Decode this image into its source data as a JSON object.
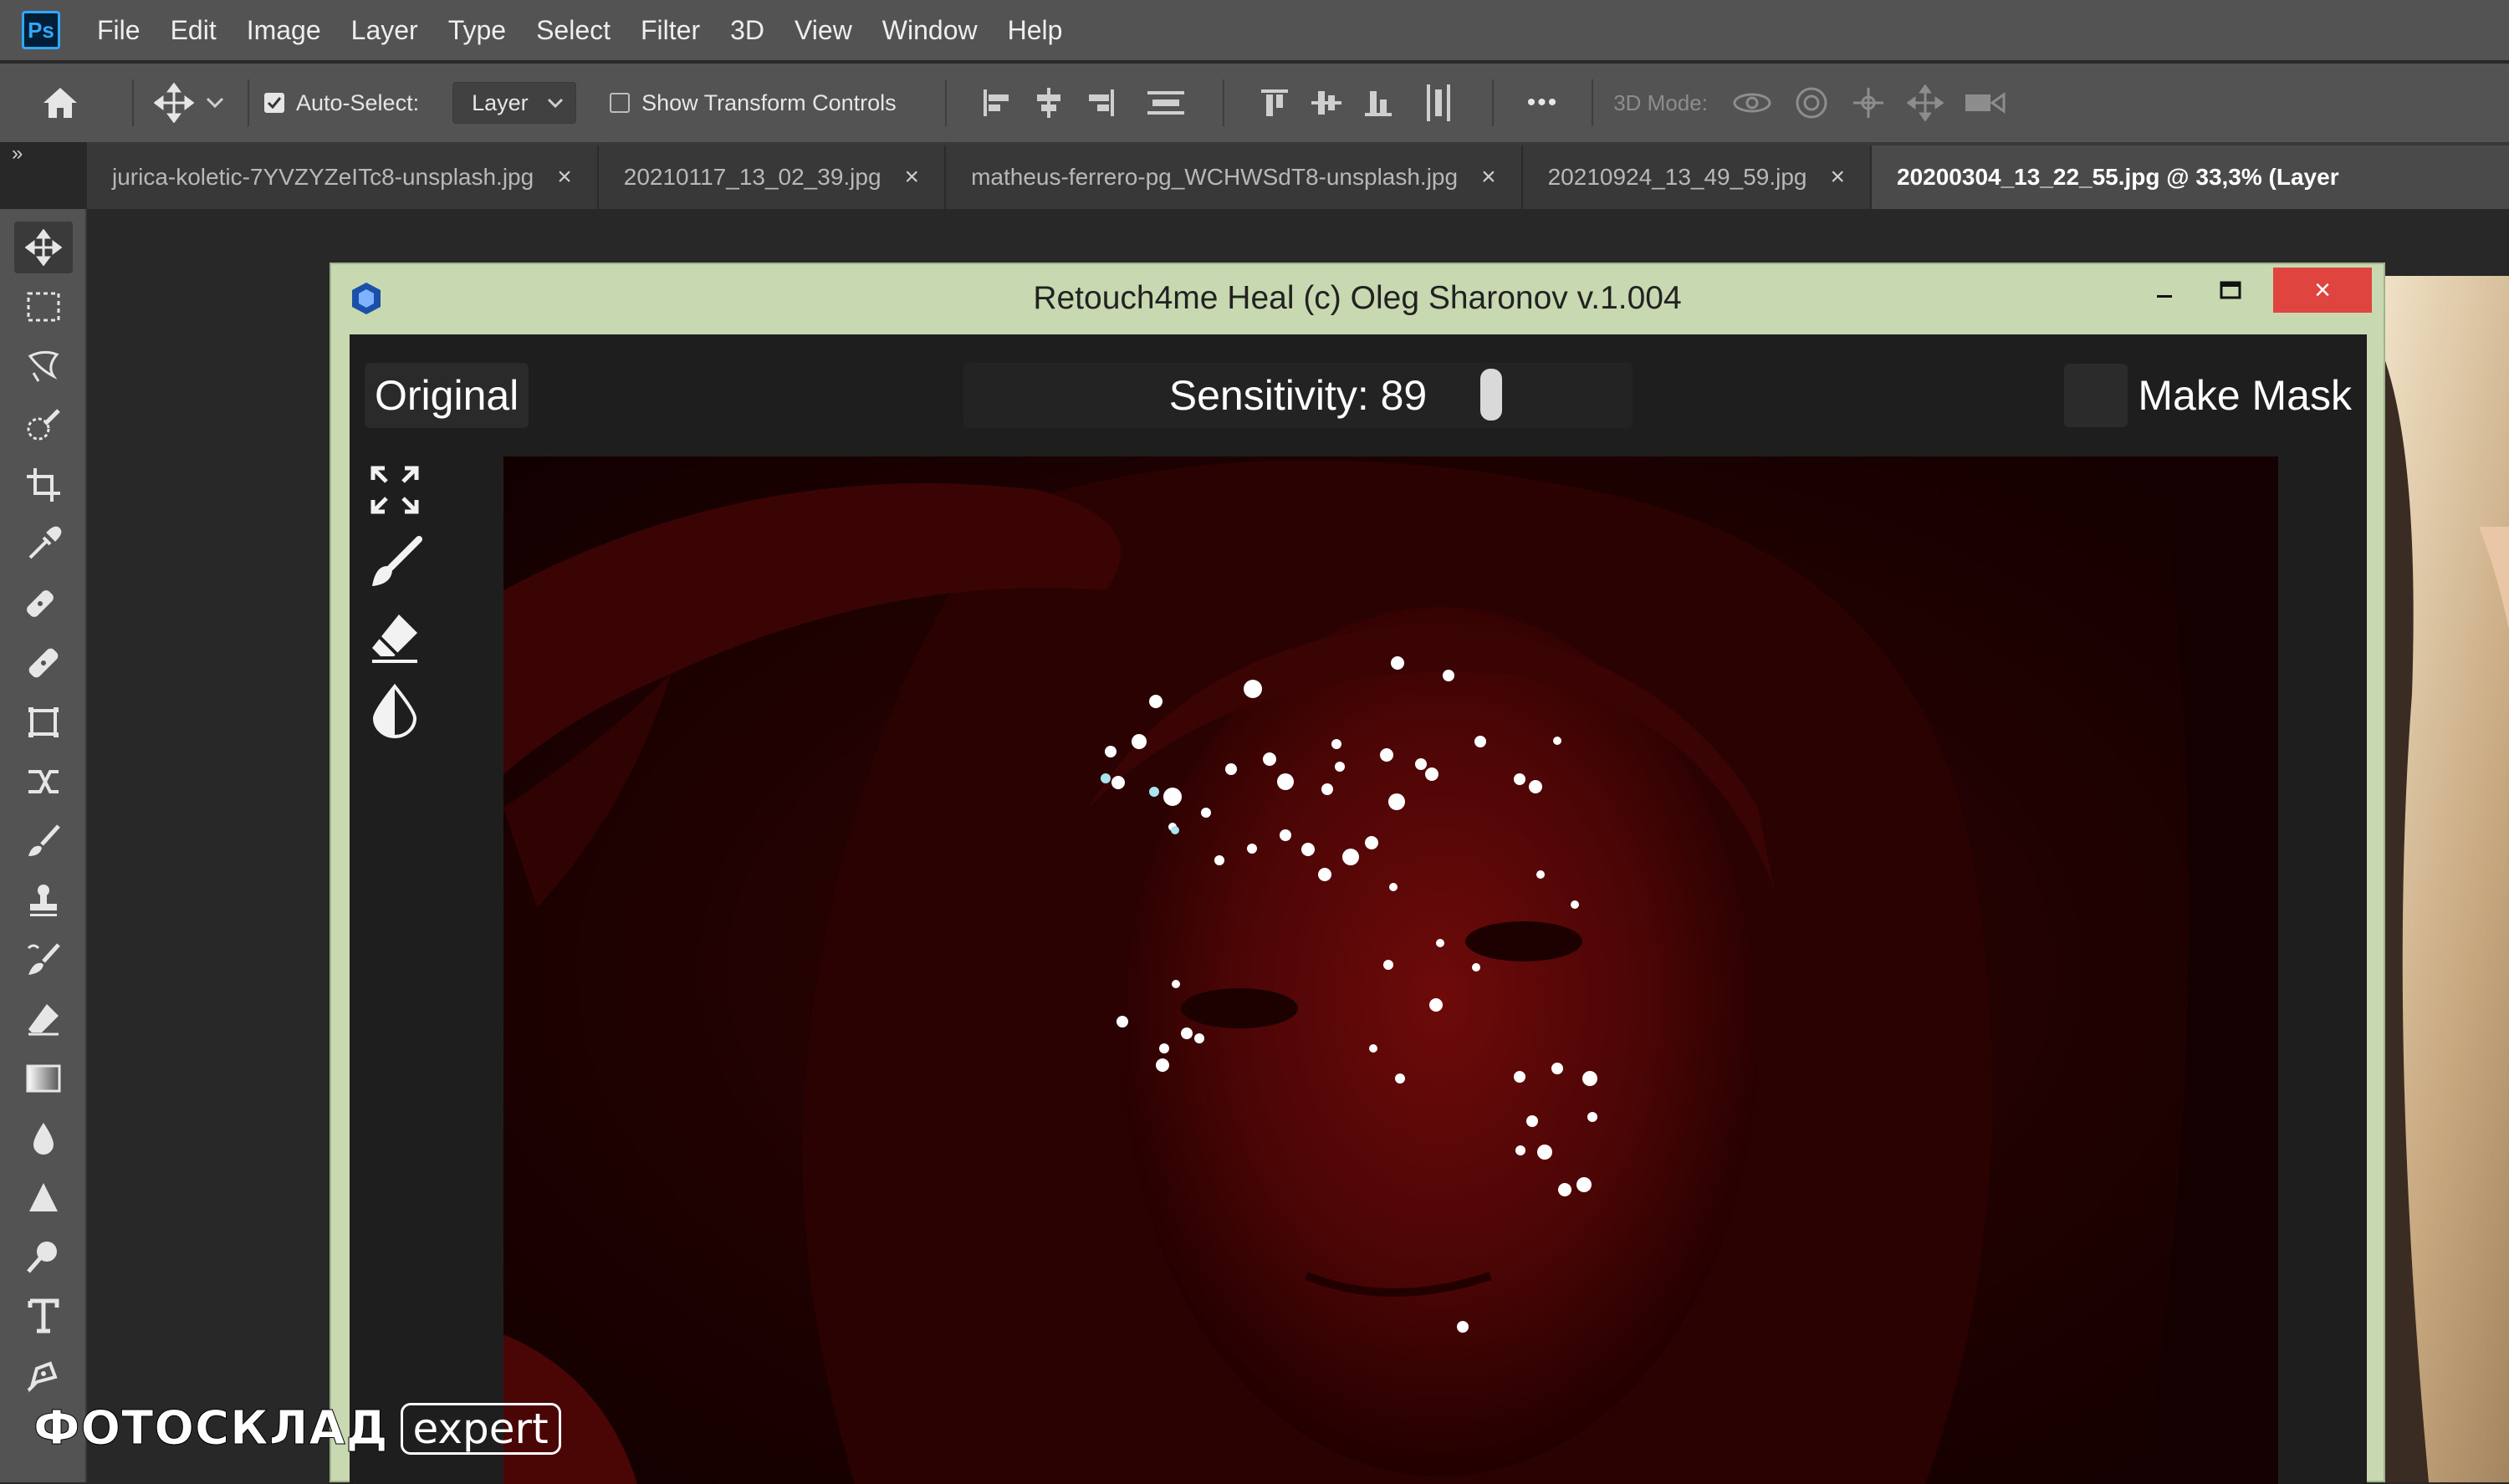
{
  "menu": {
    "logo": "Ps",
    "items": [
      "File",
      "Edit",
      "Image",
      "Layer",
      "Type",
      "Select",
      "Filter",
      "3D",
      "View",
      "Window",
      "Help"
    ]
  },
  "options": {
    "auto_select_label": "Auto-Select:",
    "auto_select_checked": true,
    "layer_select_value": "Layer",
    "show_transform_label": "Show Transform Controls",
    "more_label": "•••",
    "mode_3d_label": "3D Mode:"
  },
  "tabs": [
    {
      "label": "jurica-koletic-7YVZYZeITc8-unsplash.jpg",
      "close": "×",
      "active": false
    },
    {
      "label": "20210117_13_02_39.jpg",
      "close": "×",
      "active": false
    },
    {
      "label": "matheus-ferrero-pg_WCHWSdT8-unsplash.jpg",
      "close": "×",
      "active": false
    },
    {
      "label": "20210924_13_49_59.jpg",
      "close": "×",
      "active": false
    },
    {
      "label": "20200304_13_22_55.jpg @ 33,3% (Layer",
      "close": "",
      "active": true
    }
  ],
  "tabs_expand": "»",
  "tools": [
    "move-tool-icon",
    "marquee-tool-icon",
    "lasso-tool-icon",
    "quick-select-tool-icon",
    "crop-tool-icon",
    "eyedropper-tool-icon",
    "spot-healing-tool-icon",
    "healing-brush-tool-icon",
    "patch-tool-icon",
    "content-aware-move-tool-icon",
    "brush-tool-icon",
    "clone-stamp-tool-icon",
    "history-brush-tool-icon",
    "eraser-tool-icon",
    "gradient-tool-icon",
    "blur-tool-icon",
    "sharpen-tool-icon",
    "dodge-tool-icon",
    "type-tool-icon",
    "pen-tool-icon"
  ],
  "plugin": {
    "title": "Retouch4me Heal (c) Oleg Sharonov v.1.004",
    "minimize": "–",
    "close": "×",
    "original_label": "Original",
    "sensitivity_label": "Sensitivity: 89",
    "sensitivity_value": 89,
    "make_mask_label": "Make Mask",
    "side_tools": [
      "fit-screen-icon",
      "brush-icon",
      "eraser-icon",
      "contrast-drop-icon"
    ]
  },
  "watermark": {
    "brand": "ФОТОСКЛАД",
    "sub": "expert"
  }
}
